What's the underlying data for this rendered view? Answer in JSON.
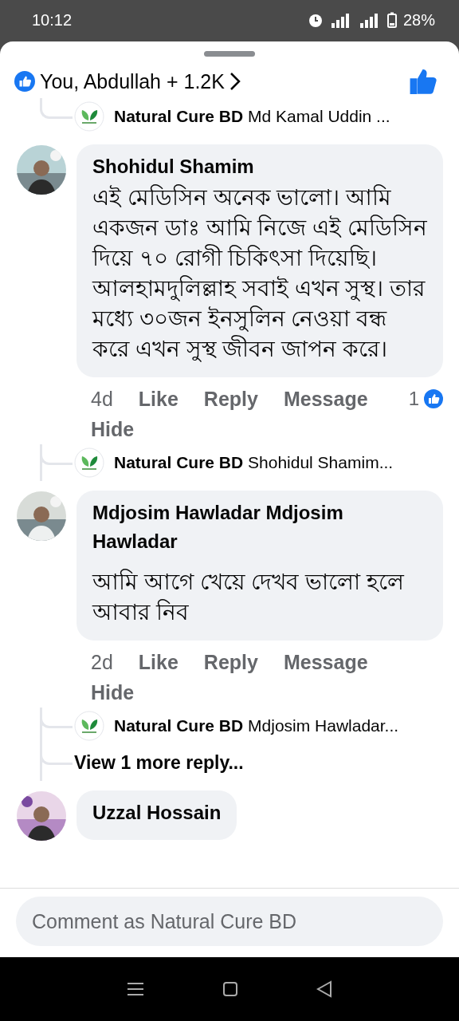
{
  "status_bar": {
    "time": "10:12",
    "battery": "28%"
  },
  "reactions": {
    "summary": "You, Abdullah + 1.2K",
    "liked": true
  },
  "top_reply": {
    "author": "Natural Cure BD",
    "preview": "Md Kamal Uddin ..."
  },
  "comments": [
    {
      "author": "Shohidul Shamim",
      "text": "এই মেডিসিন অনেক ভালো।  আমি একজন ডাঃ আমি নিজে এই মেডিসিন দিয়ে ৭০ রোগী চিকিৎসা দিয়েছি। আলহামদুলিল্লাহ  সবাই এখন সুস্থ।  তার মধ্যে ৩০জন ইনসুলিন নেওয়া বন্ধ করে এখন সুস্থ জীবন জাপন করে।",
      "time": "4d",
      "actions": [
        "Like",
        "Reply",
        "Message"
      ],
      "hide": "Hide",
      "likes": "1",
      "replies": [
        {
          "author": "Natural Cure BD",
          "preview": "Shohidul Shamim..."
        }
      ]
    },
    {
      "author": "Mdjosim Hawladar Mdjosim Hawladar",
      "text": "আমি আগে খেয়ে দেখব ভালো হলে আবার নিব",
      "time": "2d",
      "actions": [
        "Like",
        "Reply",
        "Message"
      ],
      "hide": "Hide",
      "replies": [
        {
          "author": "Natural Cure BD",
          "preview": "Mdjosim Hawladar..."
        }
      ],
      "more": "View 1 more reply..."
    },
    {
      "author": "Uzzal Hossain"
    }
  ],
  "composer": {
    "placeholder": "Comment as Natural Cure BD"
  }
}
